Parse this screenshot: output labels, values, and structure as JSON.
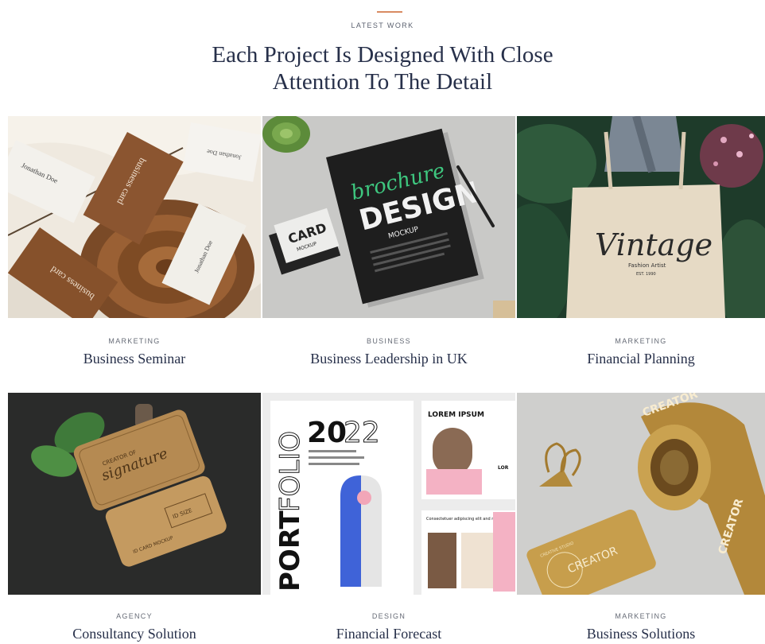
{
  "section": {
    "eyebrow": "LATEST WORK",
    "title_line1": "Each Project Is Designed With Close",
    "title_line2": "Attention To The Detail",
    "accent_color": "#d98b62"
  },
  "projects": [
    {
      "category": "MARKETING",
      "title": "Business Seminar",
      "mockup_text": {
        "card_name": "Jonathan Doe",
        "card_label": "business card",
        "card_label_2": "business card",
        "card_name_2": "Jonathan Doe",
        "card_name_3": "Jonathan Doe"
      }
    },
    {
      "category": "BUSINESS",
      "title": "Business Leadership in UK",
      "mockup_text": {
        "script": "brochure",
        "headline": "DESIGN",
        "sub": "MOCKUP",
        "card_word": "CARD",
        "card_sub": "MOCKUP"
      }
    },
    {
      "category": "MARKETING",
      "title": "Financial Planning",
      "mockup_text": {
        "script": "Vintage",
        "sub": "Fashion Artist",
        "est": "EST. 1990"
      }
    },
    {
      "category": "AGENCY",
      "title": "Consultancy Solution",
      "mockup_text": {
        "line1": "CREATOR OF",
        "script": "signature",
        "badge": "ID SIZE",
        "card_word": "ID CARD MOCKUP"
      }
    },
    {
      "category": "DESIGN",
      "title": "Financial Forecast",
      "mockup_text": {
        "year_bold": "20",
        "year_light": "22",
        "port_bold": "PORT",
        "port_light": "FOLIO",
        "lorem": "LOREM IPSUM",
        "lorem_short": "LOR",
        "para_head": "Consectetuer adipiscing elit and more"
      }
    },
    {
      "category": "MARKETING",
      "title": "Business Solutions",
      "mockup_text": {
        "tape_word": "CREATOR",
        "card_word": "CREATOR",
        "card_ring": "CREATIVE STUDIO"
      }
    }
  ]
}
